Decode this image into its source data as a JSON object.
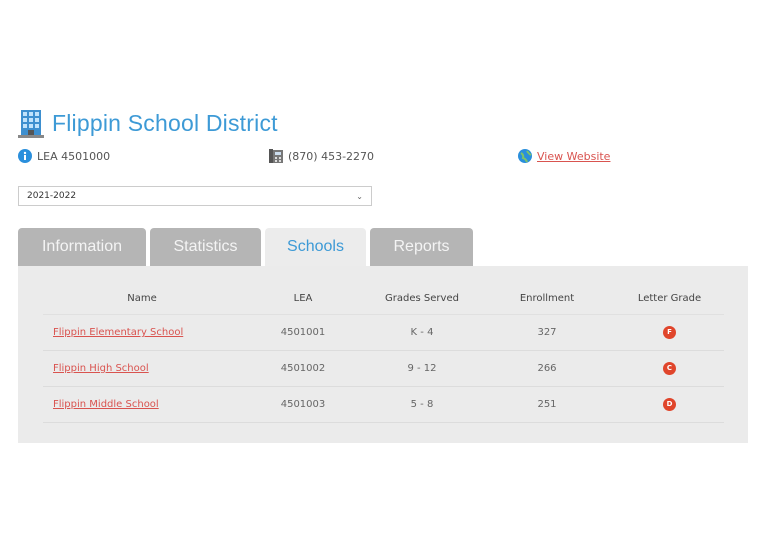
{
  "header": {
    "title": "Flippin School District",
    "lea": "LEA 4501000",
    "phone": "(870) 453-2270",
    "website_label": "View Website"
  },
  "year_select": {
    "value": "2021-2022"
  },
  "tabs": [
    {
      "label": "Information"
    },
    {
      "label": "Statistics"
    },
    {
      "label": "Schools"
    },
    {
      "label": "Reports"
    }
  ],
  "table": {
    "headers": [
      "Name",
      "LEA",
      "Grades Served",
      "Enrollment",
      "Letter Grade"
    ],
    "rows": [
      {
        "name": "Flippin Elementary School",
        "lea": "4501001",
        "grades": "K - 4",
        "enrollment": "327",
        "grade": "F"
      },
      {
        "name": "Flippin High School",
        "lea": "4501002",
        "grades": "9 - 12",
        "enrollment": "266",
        "grade": "C"
      },
      {
        "name": "Flippin Middle School",
        "lea": "4501003",
        "grades": "5 - 8",
        "enrollment": "251",
        "grade": "D"
      }
    ]
  },
  "colors": {
    "accent": "#3d9ad6",
    "link": "#d9534f",
    "grade": "#e0452b",
    "panel": "#ebebeb"
  }
}
